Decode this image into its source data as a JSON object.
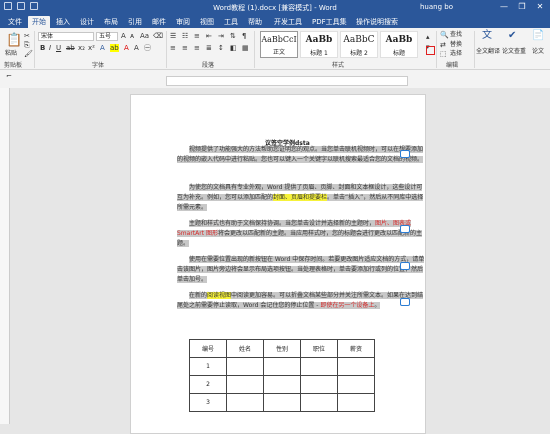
{
  "window": {
    "title": "Word教程 (1).docx [兼容模式] - Word",
    "user": "huang bo",
    "controls": [
      "—",
      "❐",
      "✕"
    ]
  },
  "tabs": [
    "文件",
    "开始",
    "插入",
    "设计",
    "布局",
    "引用",
    "邮件",
    "审阅",
    "视图",
    "工具",
    "帮助",
    "开发工具",
    "PDF工具集",
    "操作说明搜索"
  ],
  "ribbon": {
    "clipboard": {
      "paste": "粘贴",
      "group": "剪贴板"
    },
    "font": {
      "family": "宋体",
      "size": "五号",
      "group": "字体"
    },
    "paragraph": {
      "group": "段落"
    },
    "styles": {
      "group": "样式",
      "items": [
        {
          "preview": "AaBbCcI",
          "name": "正文"
        },
        {
          "preview": "AaBb",
          "name": "标题 1"
        },
        {
          "preview": "AaBbC",
          "name": "标题 2"
        },
        {
          "preview": "AaBb",
          "name": "标题"
        }
      ]
    },
    "editing": {
      "find": "查找",
      "replace": "替换",
      "select": "选择",
      "group": "编辑"
    },
    "extra": {
      "a": "全文翻译",
      "b": "论文查重",
      "c": "论文"
    }
  },
  "document": {
    "title": "议签空学例dsta",
    "paragraphs": [
      {
        "parts": [
          {
            "t": "视频提供了功能强大的方法帮助您证明您的观点。当您单击联机视频时，可以在想要添加的视频的嵌入代码中进行粘贴。您也可以键入一个关键字以联机搜索最适合您的文档的视频。",
            "c": "g"
          }
        ]
      },
      {
        "parts": [
          {
            "t": "为使您的文档具有专业外观，Word 提供了页眉、页脚、封面和文本框设计，这些设计可互为补充。例如，您可以添加匹配的",
            "c": "g"
          },
          {
            "t": "封面、页眉和提要栏",
            "c": "y"
          },
          {
            "t": "。单击“插入”，然后从不同库中选择所需元素。",
            "c": "g"
          }
        ]
      },
      {
        "parts": [
          {
            "t": "主题和样式也有助于文档保持协调。当您单击设计并选择新的主题时，",
            "c": "g"
          },
          {
            "t": "图片、图表或 SmartArt 图形",
            "c": "r"
          },
          {
            "t": "将会更改以匹配新的主题。当应用样式时，您的标题会进行更改以匹配新的主题。",
            "c": "g"
          }
        ]
      },
      {
        "parts": [
          {
            "t": "使用在需要位置出现的新按钮在 Word 中保存时间。若要更改图片适应文档的方式，请单击该图片，图片旁边将会显示布局选项按钮。当处理表格时，单击要添加行或列的位置，然后单击加号。",
            "c": "g"
          }
        ]
      },
      {
        "parts": [
          {
            "t": "在新的",
            "c": "g"
          },
          {
            "t": "阅读视图",
            "c": "y"
          },
          {
            "t": "中阅读更加容易。可以折叠文档某些部分并关注所需文本。如果在达到结尾处之前需要停止读取，Word 会记住您的停止位置 - ",
            "c": "g"
          },
          {
            "t": "即使在另一个设备上",
            "c": "r"
          },
          {
            "t": "。",
            "c": "g"
          }
        ]
      }
    ],
    "table": {
      "headers": [
        "编号",
        "姓名",
        "性别",
        "职位",
        "薪资"
      ],
      "rows": [
        [
          "1",
          "",
          "",
          "",
          ""
        ],
        [
          "2",
          "",
          "",
          "",
          ""
        ],
        [
          "3",
          "",
          "",
          "",
          ""
        ]
      ]
    }
  }
}
